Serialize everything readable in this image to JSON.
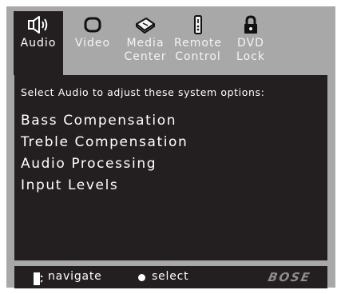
{
  "tabs": [
    {
      "label": "Audio",
      "icon": "speaker-icon",
      "active": true
    },
    {
      "label": "Video",
      "icon": "tv-screen-icon",
      "active": false
    },
    {
      "label": "Media\nCenter",
      "icon": "media-center-icon",
      "active": false
    },
    {
      "label": "Remote\nControl",
      "icon": "remote-control-icon",
      "active": false
    },
    {
      "label": "DVD\nLock",
      "icon": "lock-icon",
      "active": false
    }
  ],
  "panel": {
    "prompt": "Select Audio to adjust these system options:",
    "options": [
      "Bass Compensation",
      "Treble Compensation",
      "Audio Processing",
      "Input Levels"
    ]
  },
  "footer": {
    "navigate_label": "navigate",
    "select_label": "select",
    "brand": "BOSE"
  },
  "colors": {
    "frame": "#a9a8a8",
    "panel": "#231f20",
    "text": "#ffffff"
  }
}
